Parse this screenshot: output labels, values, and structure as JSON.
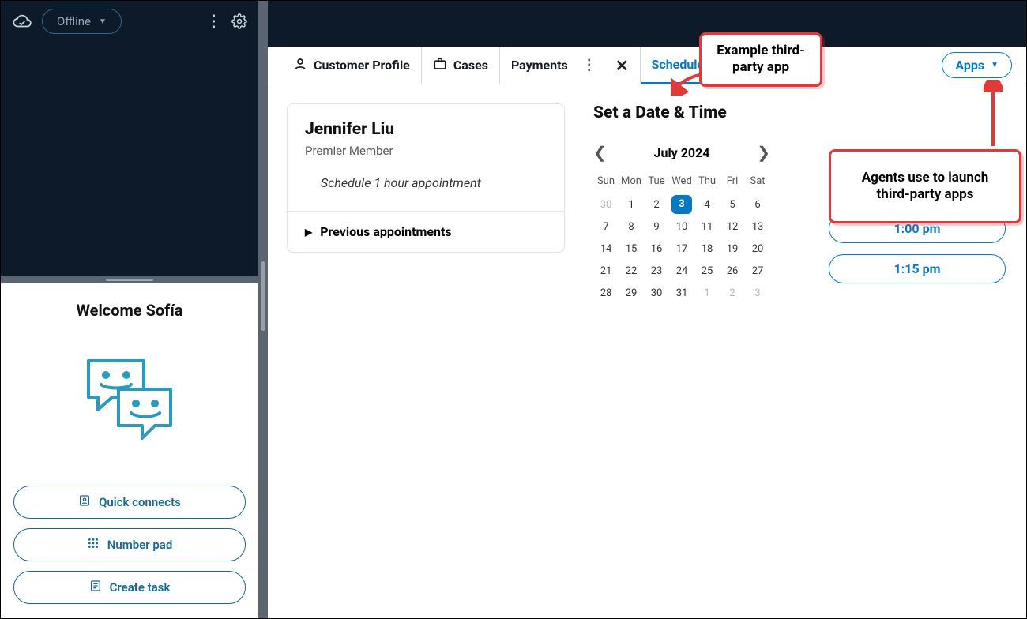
{
  "sidebar": {
    "status": "Offline",
    "welcome": "Welcome Sofía",
    "actions": {
      "quick_connects": "Quick connects",
      "number_pad": "Number pad",
      "create_task": "Create task"
    }
  },
  "tabs": {
    "profile": "Customer Profile",
    "cases": "Cases",
    "payments": "Payments",
    "scheduler": "SchedulerApp",
    "apps": "Apps"
  },
  "card": {
    "name": "Jennifer Liu",
    "membership": "Premier Member",
    "note": "Schedule 1 hour appointment",
    "previous": "Previous appointments"
  },
  "schedule": {
    "heading": "Set a Date & Time",
    "month_label": "July 2024",
    "dow": [
      "Sun",
      "Mon",
      "Tue",
      "Wed",
      "Thu",
      "Fri",
      "Sat"
    ],
    "weeks": [
      [
        {
          "d": "30",
          "muted": true
        },
        {
          "d": "1"
        },
        {
          "d": "2"
        },
        {
          "d": "3",
          "sel": true
        },
        {
          "d": "4"
        },
        {
          "d": "5"
        },
        {
          "d": "6"
        }
      ],
      [
        {
          "d": "7"
        },
        {
          "d": "8"
        },
        {
          "d": "9"
        },
        {
          "d": "10"
        },
        {
          "d": "11"
        },
        {
          "d": "12"
        },
        {
          "d": "13"
        }
      ],
      [
        {
          "d": "14"
        },
        {
          "d": "15"
        },
        {
          "d": "16"
        },
        {
          "d": "17"
        },
        {
          "d": "18"
        },
        {
          "d": "19"
        },
        {
          "d": "20"
        }
      ],
      [
        {
          "d": "21"
        },
        {
          "d": "22"
        },
        {
          "d": "23"
        },
        {
          "d": "24"
        },
        {
          "d": "25"
        },
        {
          "d": "26"
        },
        {
          "d": "27"
        }
      ],
      [
        {
          "d": "28"
        },
        {
          "d": "29"
        },
        {
          "d": "30"
        },
        {
          "d": "31"
        },
        {
          "d": "1",
          "muted": true
        },
        {
          "d": "2",
          "muted": true
        },
        {
          "d": "3",
          "muted": true
        }
      ]
    ],
    "slots": [
      "1:00 pm",
      "1:15 pm"
    ]
  },
  "callouts": {
    "c1": "Example third-party app",
    "c2": "Agents use to launch third-party apps"
  }
}
